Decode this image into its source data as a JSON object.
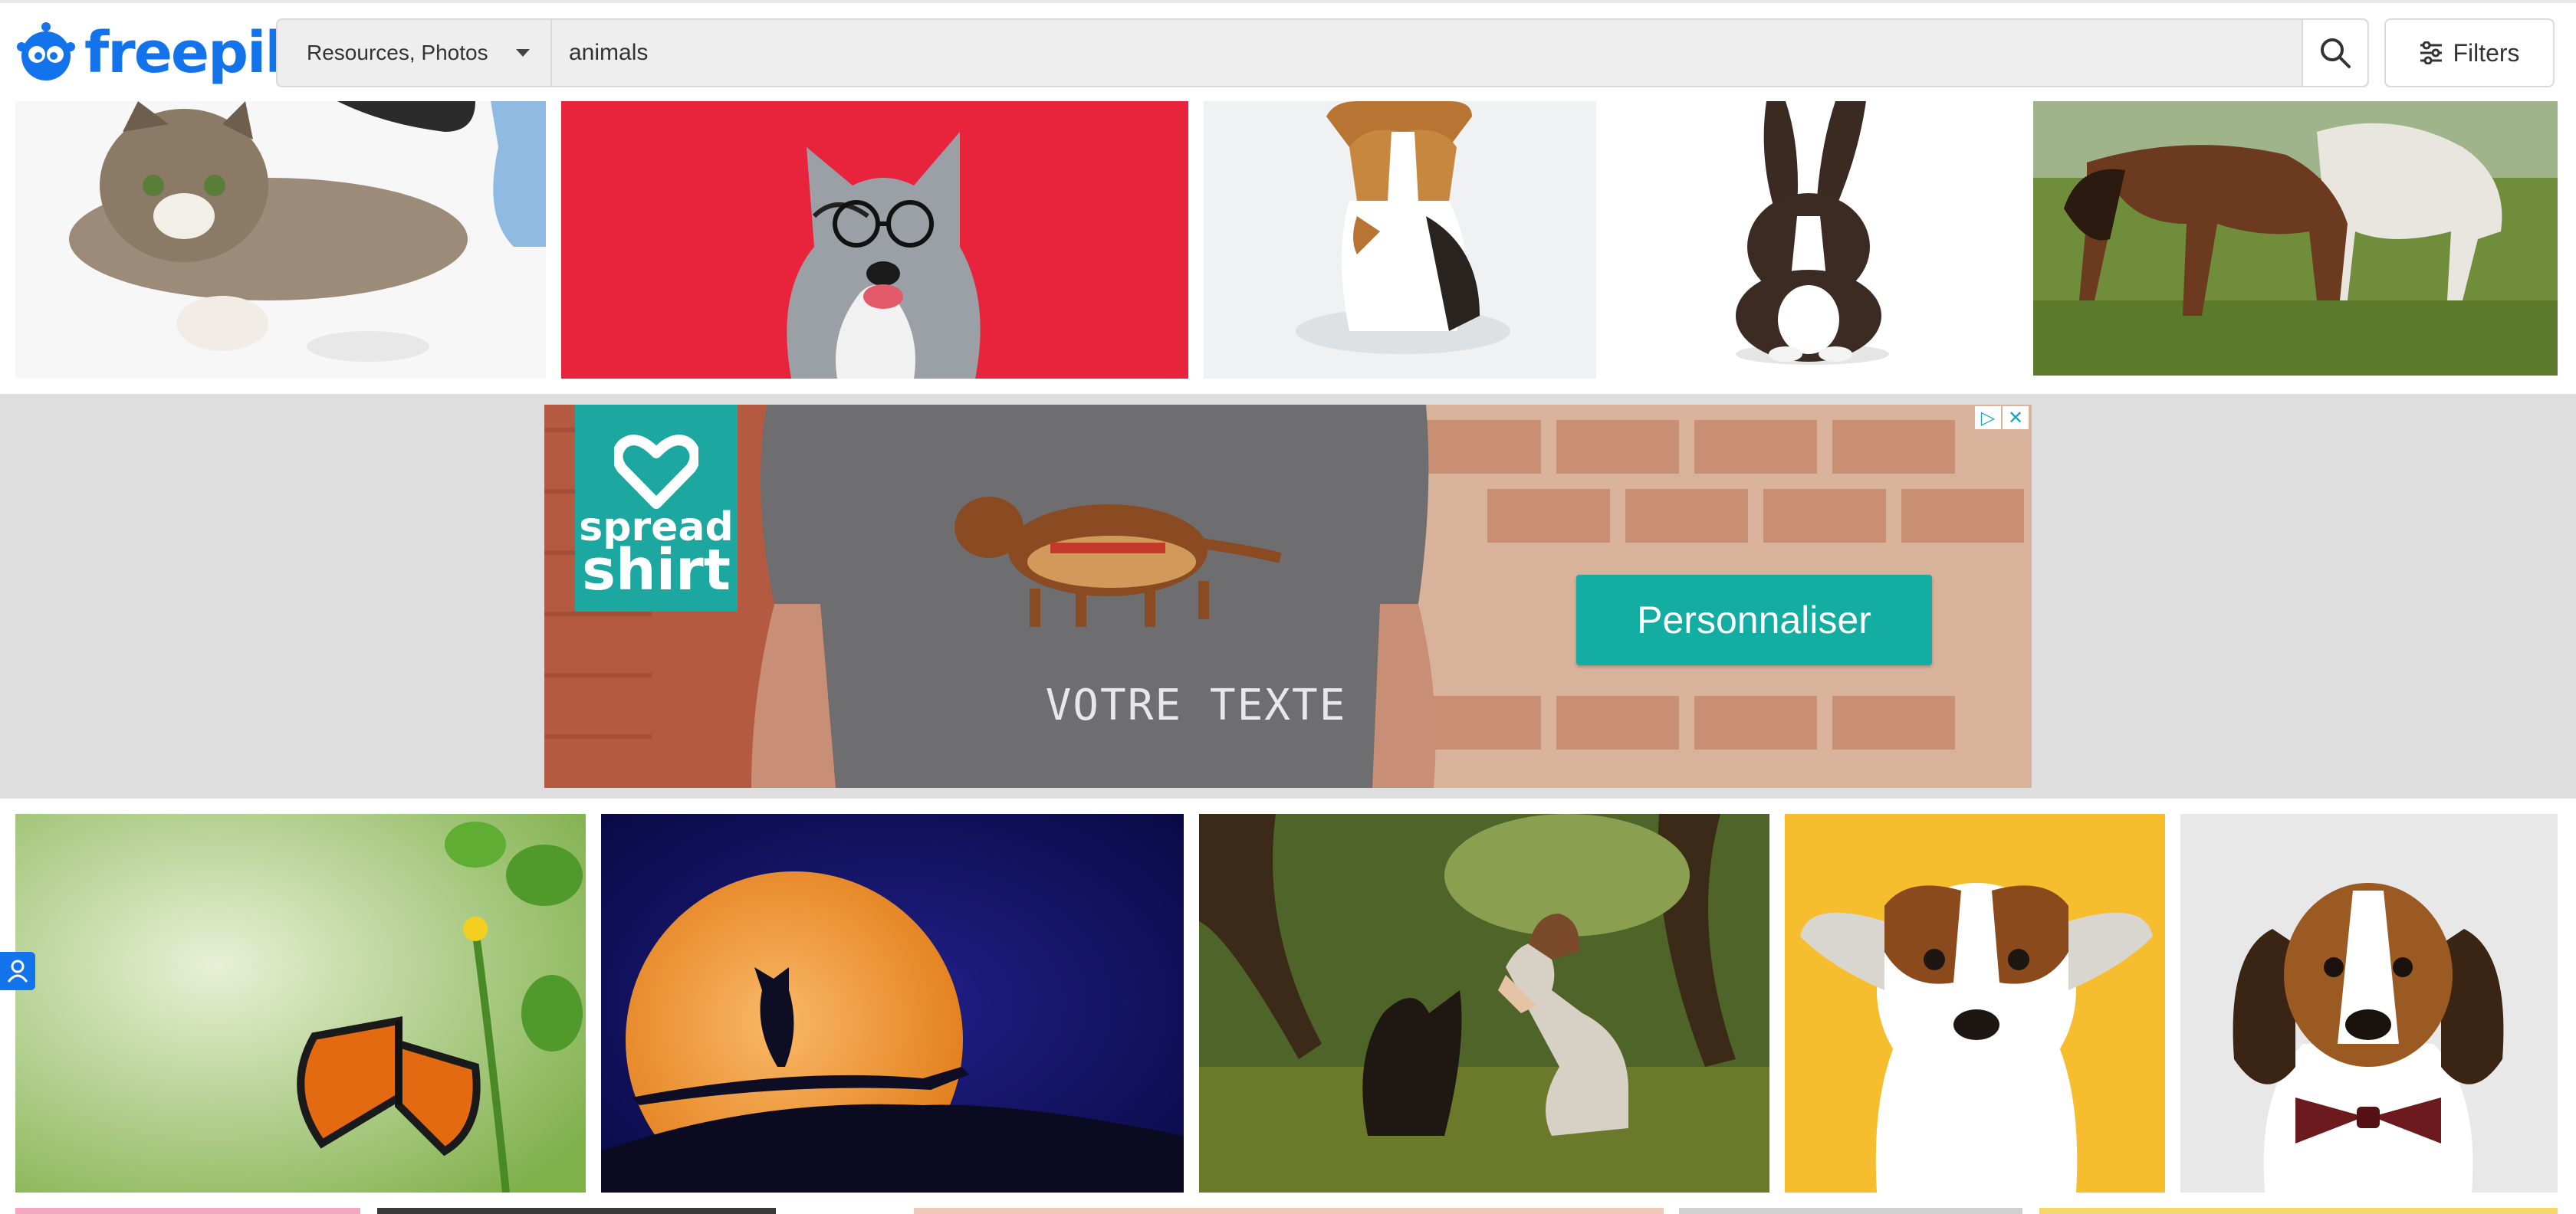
{
  "header": {
    "logo_text": "freepik",
    "resource_select": {
      "label": "Resources, Photos"
    },
    "search": {
      "value": "animals",
      "placeholder": ""
    },
    "filters_label": "Filters"
  },
  "results_row_1": [
    {
      "name": "kitten"
    },
    {
      "name": "dog-with-glasses"
    },
    {
      "name": "beagle-sitting"
    },
    {
      "name": "rabbit"
    },
    {
      "name": "horses-grazing"
    }
  ],
  "ad": {
    "brand_line1": "spread",
    "brand_line2": "shirt",
    "shirt_text": "VOTRE TEXTE",
    "cta_label": "Personnaliser",
    "adchoices_icon": "▷",
    "close_icon": "✕"
  },
  "results_row_2": [
    {
      "name": "butterfly"
    },
    {
      "name": "owl-moon"
    },
    {
      "name": "woman-and-dog"
    },
    {
      "name": "puppy-yellow"
    },
    {
      "name": "beagle-bowtie"
    }
  ],
  "colors": {
    "brand_blue": "#1273eb",
    "ad_teal": "#13ada1"
  }
}
